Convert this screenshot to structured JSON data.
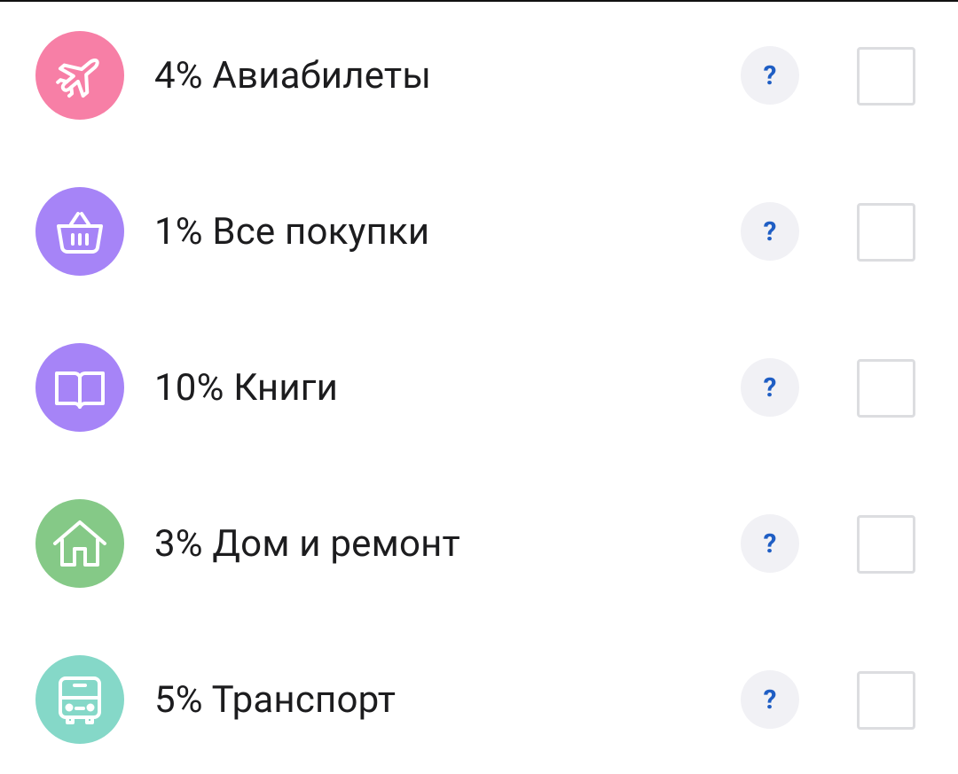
{
  "categories": [
    {
      "label": "4% Авиабилеты",
      "icon": "airplane-icon",
      "color": "#f77fa6",
      "checked": false
    },
    {
      "label": "1% Все покупки",
      "icon": "basket-icon",
      "color": "#a684f7",
      "checked": false
    },
    {
      "label": "10% Книги",
      "icon": "book-icon",
      "color": "#a684f7",
      "checked": false
    },
    {
      "label": "3% Дом и ремонт",
      "icon": "house-icon",
      "color": "#85c987",
      "checked": false
    },
    {
      "label": "5% Транспорт",
      "icon": "bus-icon",
      "color": "#85d8c8",
      "checked": false
    }
  ],
  "help_symbol": "?"
}
